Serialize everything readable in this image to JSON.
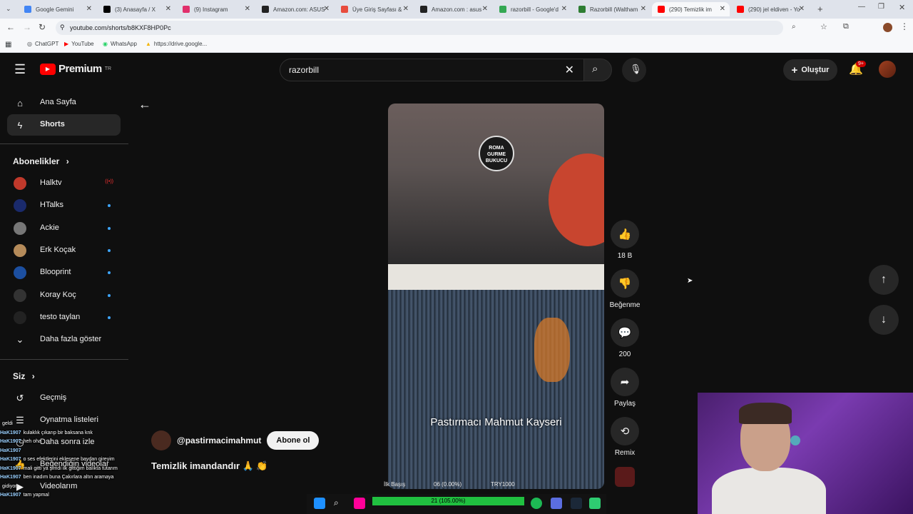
{
  "browser": {
    "tabs": [
      {
        "title": "Google Gemini",
        "color": "#4285f4"
      },
      {
        "title": "(3) Anasayfa / X",
        "color": "#000000"
      },
      {
        "title": "(9) Instagram",
        "color": "#e1306c"
      },
      {
        "title": "Amazon.com: ASUS",
        "color": "#222222"
      },
      {
        "title": "Üye Giriş Sayfası & ",
        "color": "#e84c3d"
      },
      {
        "title": "Amazon.com : asus",
        "color": "#222222"
      },
      {
        "title": "razorbill - Google'd",
        "color": "#34a853"
      },
      {
        "title": "Razorbill (Waltham",
        "color": "#2e7d32"
      },
      {
        "title": "(290) Temizlik im",
        "color": "#ff0000"
      },
      {
        "title": "(290) jel eldiven - Yo",
        "color": "#ff0000"
      }
    ],
    "url": "youtube.com/shorts/b8KXF8HP0Pc",
    "bookmarks": [
      "ChatGPT",
      "YouTube",
      "WhatsApp",
      "https://drive.google..."
    ]
  },
  "header": {
    "logo_text": "Premium",
    "logo_region": "TR",
    "search_value": "razorbill",
    "create_label": "Oluştur",
    "notif_count": "9+"
  },
  "sidebar": {
    "home": "Ana Sayfa",
    "shorts": "Shorts",
    "subs_title": "Abonelikler",
    "subs": [
      {
        "name": "Halktv",
        "color": "#c0392b"
      },
      {
        "name": "HTalks",
        "color": "#1a2a6c"
      },
      {
        "name": "Ackie",
        "color": "#777777"
      },
      {
        "name": "Erk Koçak",
        "color": "#b58b5a"
      },
      {
        "name": "Blooprint",
        "color": "#1c4fa0"
      },
      {
        "name": "Koray Koç",
        "color": "#333333"
      },
      {
        "name": "testo taylan",
        "color": "#222222"
      }
    ],
    "show_more": "Daha fazla göster",
    "you_title": "Siz",
    "history": "Geçmiş",
    "playlists": "Oynatma listeleri",
    "watch_later": "Daha sonra izle",
    "liked": "Beğendiğin videolar",
    "your_videos": "Videolarım"
  },
  "short": {
    "overlay_text": "Pastırmacı Mahmut Kayseri",
    "logo_text_1": "ROMA",
    "logo_text_2": "GURME",
    "logo_text_3": "BUKUCU",
    "channel": "@pastirmacimahmut",
    "subscribe": "Abone ol",
    "caption": "Temizlik imandandır 🙏 👏",
    "likes": "18 B",
    "dislike": "Beğenme",
    "comments": "200",
    "share": "Paylaş",
    "remix": "Remix"
  },
  "chat": [
    {
      "user": "",
      "msg": "geldi"
    },
    {
      "user": "HaK1907",
      "msg": "kulaklık çıkarıp bir baksana knk"
    },
    {
      "user": "HaK1907",
      "msg": "heh oha"
    },
    {
      "user": "HaK1907",
      "msg": ""
    },
    {
      "user": "HaK1907",
      "msg": "o ses efektlerini eklesene baydan gireyim"
    },
    {
      "user": "HaK1907",
      "msg": "mali gitti ya şimdi ilk gittiğim balıkta tutarım"
    },
    {
      "user": "HaK1907",
      "msg": "ben inadım buna Çakırlara altın aramaya"
    },
    {
      "user": "",
      "msg": "gidiyor"
    },
    {
      "user": "HaK1907",
      "msg": "tam yapmal"
    }
  ],
  "overlay_stats": {
    "left": "İlk Başış",
    "mid": "06 (0.00%)",
    "right": "TRY1000",
    "bar": "21 (105.00%)",
    "bar_percent": 100
  }
}
